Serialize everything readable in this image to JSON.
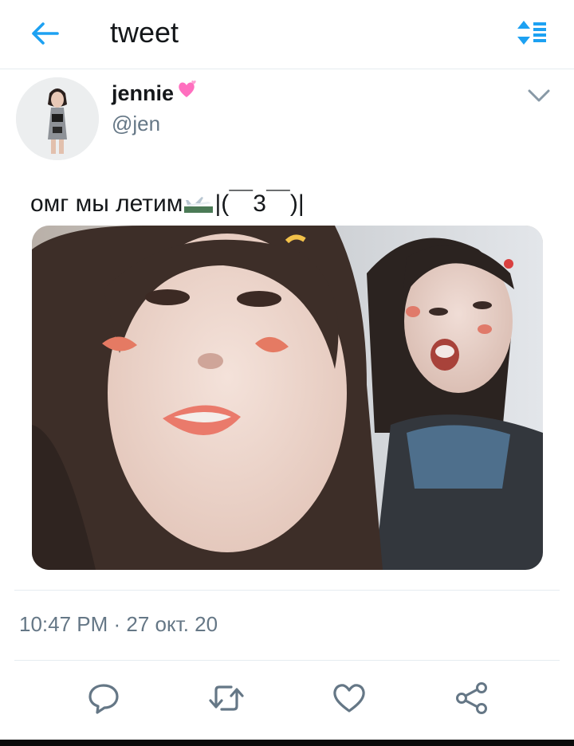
{
  "header": {
    "title": "tweet",
    "back_icon": "arrow-left-icon",
    "sort_icon": "sort-icon"
  },
  "author": {
    "name": "jennie",
    "name_emoji": "heart-icon",
    "handle": "@jen",
    "menu_icon": "chevron-down-icon"
  },
  "tweet": {
    "text_before": "омг мы летим",
    "text_after": "|(￣3￣)|",
    "inline_icon": "airplane-icon"
  },
  "meta": {
    "timestamp": "10:47 PM · 27 окт. 20"
  },
  "actions": {
    "reply_icon": "reply-icon",
    "retweet_icon": "retweet-icon",
    "like_icon": "heart-outline-icon",
    "share_icon": "share-icon"
  },
  "colors": {
    "accent": "#1da1f2",
    "text": "#14171a",
    "secondary": "#657786",
    "divider": "#e6ecf0"
  }
}
